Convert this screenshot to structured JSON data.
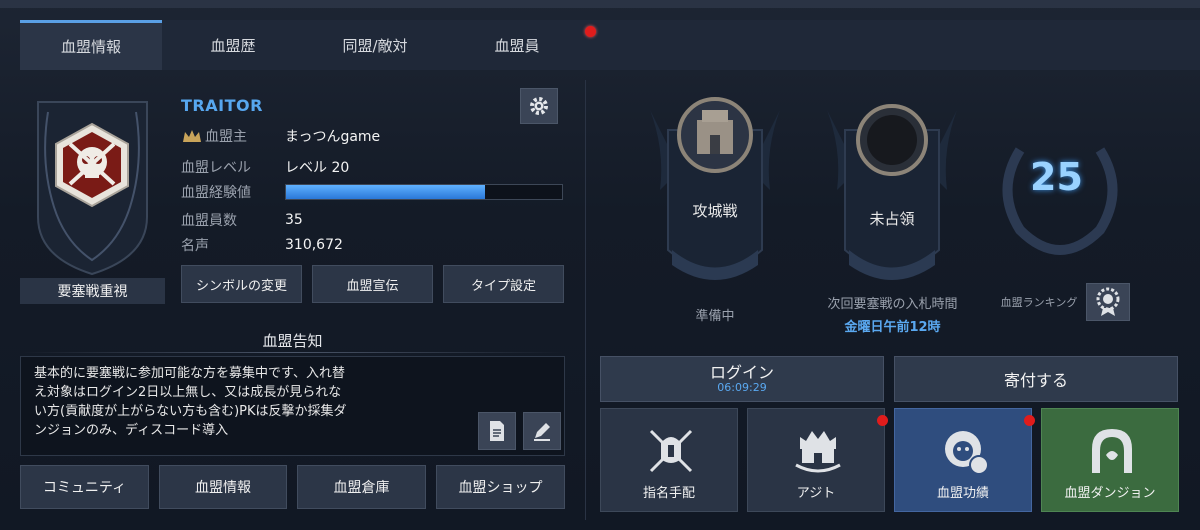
{
  "tabs": [
    {
      "label": "血盟情報",
      "active": true
    },
    {
      "label": "血盟歴"
    },
    {
      "label": "同盟/敵対"
    },
    {
      "label": "血盟員",
      "has_notification": true
    }
  ],
  "clan": {
    "name": "TRAITOR",
    "type_label": "要塞戦重視",
    "rows": [
      {
        "label": "血盟主",
        "value": "まっつんgame"
      },
      {
        "label": "血盟レベル",
        "value": "レベル 20"
      },
      {
        "label": "血盟経験値",
        "value": ""
      },
      {
        "label": "血盟員数",
        "value": "35"
      },
      {
        "label": "名声",
        "value": "310,672"
      }
    ],
    "exp_fraction": 0.72
  },
  "actions": {
    "change_symbol": "シンボルの変更",
    "promote": "血盟宣伝",
    "type_setting": "タイプ設定"
  },
  "notice": {
    "title": "血盟告知",
    "text": "基本的に要塞戦に参加可能な方を募集中です、入れ替\nえ対象はログイン2日以上無し、又は成長が見られな\nい方(貢献度が上がらない方も含む)PKは反撃か採集ダ\nンジョンのみ、ディスコード導入"
  },
  "bottom_buttons": [
    "コミュニティ",
    "血盟情報",
    "血盟倉庫",
    "血盟ショップ"
  ],
  "war": {
    "siege_label": "攻城戦",
    "siege_status": "準備中",
    "fortress_label": "未占領",
    "next_bid_label": "次回要塞戦の入札時間",
    "next_bid_time": "金曜日午前12時",
    "rank": "25",
    "rank_label": "血盟ランキング"
  },
  "login": {
    "label": "ログイン",
    "timer": "06:09:29"
  },
  "donate_label": "寄付する",
  "tiles": [
    {
      "label": "指名手配",
      "has_notification": false
    },
    {
      "label": "アジト",
      "has_notification": true
    },
    {
      "label": "血盟功績",
      "has_notification": true
    },
    {
      "label": "血盟ダンジョン",
      "has_notification": false
    }
  ],
  "colors": {
    "accent_blue": "#57a7ef",
    "notification_red": "#e01c1c",
    "dungeon_green": "#3b6b3f",
    "achievement_blue": "#2f4d7e"
  }
}
